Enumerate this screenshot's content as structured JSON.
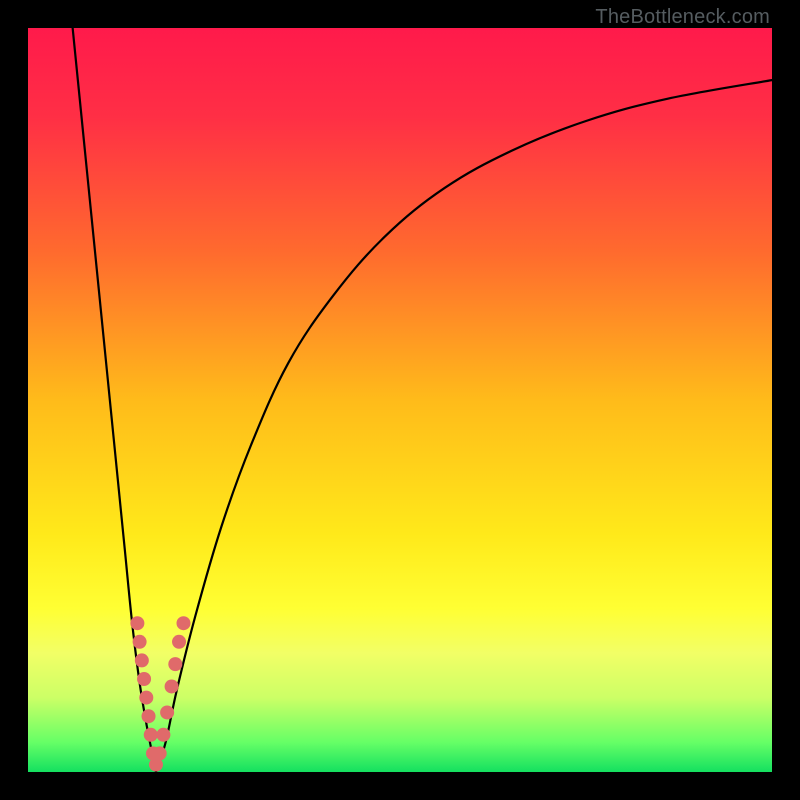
{
  "watermark": "TheBottleneck.com",
  "chart_data": {
    "type": "line",
    "title": "",
    "xlabel": "",
    "ylabel": "",
    "xlim": [
      0,
      100
    ],
    "ylim": [
      0,
      100
    ],
    "grid": false,
    "legend": false,
    "gradient_stops": [
      {
        "pct": 0,
        "color": "#ff1a4b"
      },
      {
        "pct": 12,
        "color": "#ff2f45"
      },
      {
        "pct": 30,
        "color": "#ff6a2e"
      },
      {
        "pct": 50,
        "color": "#ffbb1a"
      },
      {
        "pct": 68,
        "color": "#ffe91a"
      },
      {
        "pct": 78,
        "color": "#ffff33"
      },
      {
        "pct": 84,
        "color": "#f2ff66"
      },
      {
        "pct": 90,
        "color": "#ccff66"
      },
      {
        "pct": 96,
        "color": "#66ff66"
      },
      {
        "pct": 100,
        "color": "#14e060"
      }
    ],
    "series": [
      {
        "name": "bottleneck-left",
        "stroke": "#000000",
        "width": 2.2,
        "points": [
          {
            "x": 6.0,
            "y": 100.0
          },
          {
            "x": 7.0,
            "y": 90.0
          },
          {
            "x": 8.0,
            "y": 80.0
          },
          {
            "x": 9.0,
            "y": 70.0
          },
          {
            "x": 10.0,
            "y": 60.0
          },
          {
            "x": 11.0,
            "y": 50.0
          },
          {
            "x": 12.0,
            "y": 40.0
          },
          {
            "x": 13.0,
            "y": 30.0
          },
          {
            "x": 14.0,
            "y": 20.0
          },
          {
            "x": 15.0,
            "y": 12.0
          },
          {
            "x": 16.0,
            "y": 6.0
          },
          {
            "x": 16.8,
            "y": 2.0
          },
          {
            "x": 17.2,
            "y": 0.0
          }
        ]
      },
      {
        "name": "bottleneck-right",
        "stroke": "#000000",
        "width": 2.2,
        "points": [
          {
            "x": 17.2,
            "y": 0.0
          },
          {
            "x": 18.5,
            "y": 4.0
          },
          {
            "x": 20.0,
            "y": 11.0
          },
          {
            "x": 22.5,
            "y": 21.0
          },
          {
            "x": 26.0,
            "y": 33.0
          },
          {
            "x": 30.0,
            "y": 44.0
          },
          {
            "x": 35.0,
            "y": 55.0
          },
          {
            "x": 41.0,
            "y": 64.0
          },
          {
            "x": 48.0,
            "y": 72.0
          },
          {
            "x": 56.0,
            "y": 78.5
          },
          {
            "x": 65.0,
            "y": 83.5
          },
          {
            "x": 75.0,
            "y": 87.5
          },
          {
            "x": 86.0,
            "y": 90.5
          },
          {
            "x": 100.0,
            "y": 93.0
          }
        ]
      }
    ],
    "markers": {
      "name": "sample-points",
      "fill": "#e06a6a",
      "radius": 7,
      "points": [
        {
          "x": 14.7,
          "y": 20.0
        },
        {
          "x": 15.0,
          "y": 17.5
        },
        {
          "x": 15.3,
          "y": 15.0
        },
        {
          "x": 15.6,
          "y": 12.5
        },
        {
          "x": 15.9,
          "y": 10.0
        },
        {
          "x": 16.2,
          "y": 7.5
        },
        {
          "x": 16.5,
          "y": 5.0
        },
        {
          "x": 16.8,
          "y": 2.5
        },
        {
          "x": 17.2,
          "y": 1.0
        },
        {
          "x": 17.7,
          "y": 2.5
        },
        {
          "x": 18.2,
          "y": 5.0
        },
        {
          "x": 18.7,
          "y": 8.0
        },
        {
          "x": 19.3,
          "y": 11.5
        },
        {
          "x": 19.8,
          "y": 14.5
        },
        {
          "x": 20.3,
          "y": 17.5
        },
        {
          "x": 20.9,
          "y": 20.0
        }
      ]
    }
  }
}
